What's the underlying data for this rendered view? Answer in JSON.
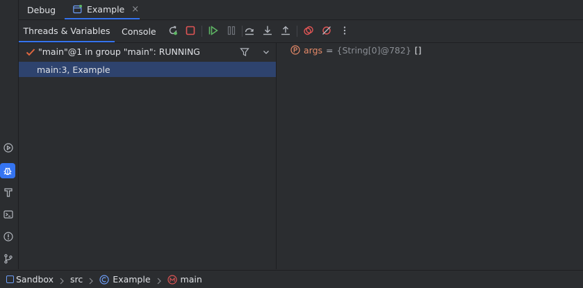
{
  "top_tabs": {
    "debug": "Debug",
    "example": "Example",
    "close_glyph": "×"
  },
  "toolbar": {
    "threads_tab": "Threads & Variables",
    "console_tab": "Console"
  },
  "thread": {
    "label": "\"main\"@1 in group \"main\": RUNNING"
  },
  "frames": [
    {
      "label": "main:3, Example"
    }
  ],
  "variables": [
    {
      "name": "args",
      "equals": "=",
      "value": "{String[0]@782}",
      "brackets": "[]"
    }
  ],
  "breadcrumb": {
    "project": "Sandbox",
    "folder": "src",
    "class": "Example",
    "method": "main"
  },
  "colors": {
    "accent": "#3574f0",
    "selected_row": "#2e436e",
    "var_name": "#e88b69",
    "stop_red": "#e05555",
    "resume_green": "#5fb865"
  }
}
